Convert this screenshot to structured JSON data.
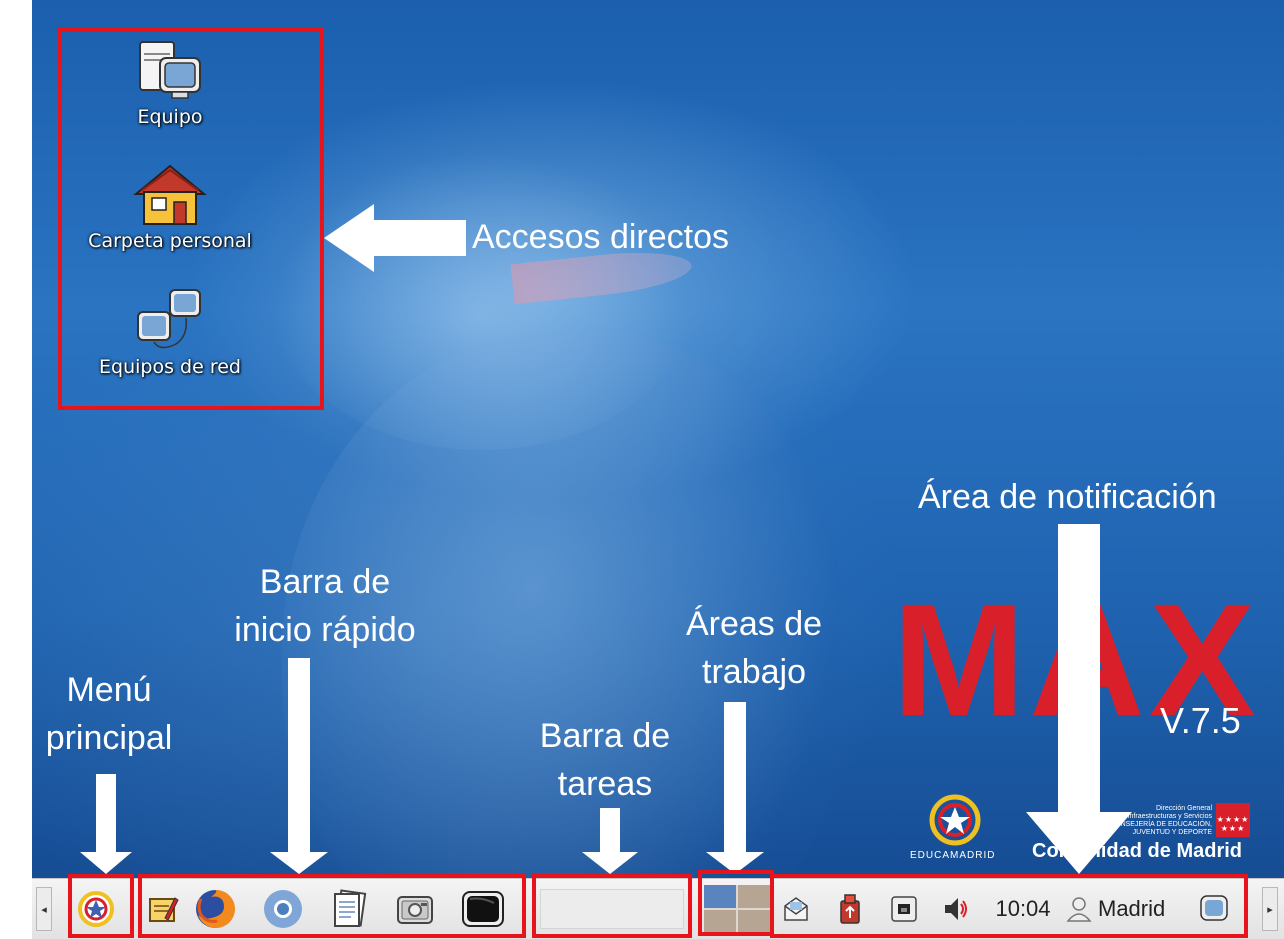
{
  "desktop": {
    "icons": [
      {
        "label": "Equipo",
        "icon": "computer-icon"
      },
      {
        "label": "Carpeta personal",
        "icon": "home-folder-icon"
      },
      {
        "label": "Equipos de red",
        "icon": "network-icon"
      }
    ],
    "wallpaper": {
      "logo": "MAX",
      "version": "V.7.5",
      "educamadrid": "EDUCAMADRID",
      "comunidad": "Comunidad de Madrid",
      "org_lines": [
        "Dirección General",
        "de Infraestructuras y Servicios",
        "CONSEJERÍA DE EDUCACIÓN,",
        "JUVENTUD Y DEPORTE"
      ]
    }
  },
  "annotations": {
    "accesos": "Accesos directos",
    "notificacion": "Área de notificación",
    "barra_inicio_1": "Barra de",
    "barra_inicio_2": "inicio rápido",
    "areas_1": "Áreas de",
    "areas_2": "trabajo",
    "menu_1": "Menú",
    "menu_2": "principal",
    "tareas_1": "Barra de",
    "tareas_2": "tareas"
  },
  "taskbar": {
    "clock": "10:04",
    "user": "Madrid"
  },
  "colors": {
    "highlight": "#e8141c",
    "max_red": "#d9202a",
    "max_blue": "#3f5fb0"
  }
}
